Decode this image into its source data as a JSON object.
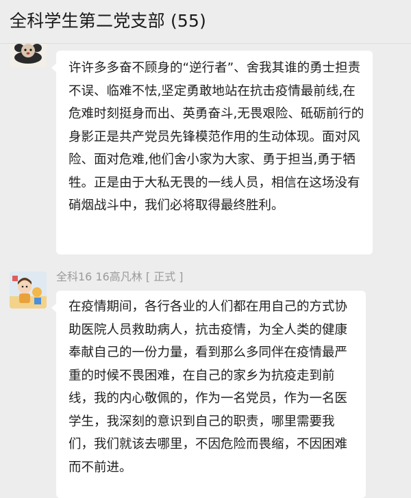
{
  "header": {
    "title": "全科学生第二党支部 (55)"
  },
  "messages": [
    {
      "sender": "",
      "avatar": "cartoon-mouse-avatar",
      "text": "许许多多奋不顾身的“逆行者”、舍我其谁的勇士担责不误、临难不怯,坚定勇敢地站在抗击疫情最前线,在危难时刻挺身而出、英勇奋斗,无畏艰险、砥砺前行的身影正是共产党员先锋模范作用的生动体现。面对风险、面对危难,他们舍小家为大家、勇于担当,勇于牺牲。正是由于大私无畏的一线人员，相信在这场没有硝烟战斗中，我们必将取得最终胜利。"
    },
    {
      "sender": "全科16 16高凡林 [ 正式 ]",
      "avatar": "cartoon-child-avatar",
      "text": "在疫情期间，各行各业的人们都在用自己的方式协助医院人员救助病人，抗击疫情，为全人类的健康奉献自己的一份力量，看到那么多同伴在疫情最严重的时候不畏困难，在自己的家乡为抗疫走到前线，我的内心敬佩的，作为一名党员，作为一名医学生，我深刻的意识到自己的职责，哪里需要我们，我们就该去哪里，不因危险而畏缩，不因困难而不前进。"
    }
  ]
}
